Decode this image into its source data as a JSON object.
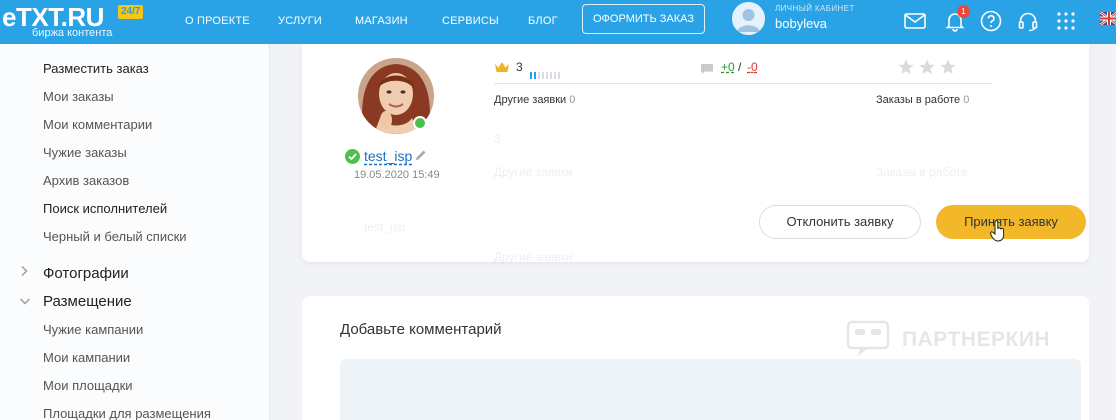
{
  "header": {
    "logo_text": "eTXT.RU",
    "logo_badge": "24/7",
    "logo_sub": "биржа контента",
    "nav": [
      "О ПРОЕКТЕ",
      "УСЛУГИ",
      "МАГАЗИН",
      "СЕРВИСЫ",
      "БЛОГ"
    ],
    "order_button": "ОФОРМИТЬ ЗАКАЗ",
    "cabinet_label": "ЛИЧНЫЙ КАБИНЕТ",
    "username": "bobyleva",
    "notification_count": "1",
    "icons": [
      "mail-icon",
      "bell-icon",
      "help-icon",
      "headset-icon",
      "apps-grid-icon",
      "uk-flag-icon"
    ]
  },
  "sidebar": {
    "items": [
      "Разместить заказ",
      "Мои заказы",
      "Мои комментарии",
      "Чужие заказы",
      "Архив заказов",
      "Поиск исполнителей",
      "Черный и белый списки"
    ],
    "cat_photos": "Фотографии",
    "cat_placement": "Размещение",
    "sub_items": [
      "Чужие кампании",
      "Мои кампании",
      "Мои площадки",
      "Площадки для размещения"
    ]
  },
  "request": {
    "username": "test_isp",
    "date": "19.05.2020 15:49",
    "rating": "3",
    "positive": "+0",
    "separator": "/",
    "negative": "-0",
    "other_requests_label": "Другие заявки",
    "other_requests_count": "0",
    "orders_in_work_label": "Заказы в работе",
    "orders_in_work_count": "0",
    "reject_button": "Отклонить заявку",
    "accept_button": "Принять заявку"
  },
  "comment": {
    "title": "Добавьте комментарий"
  },
  "watermark": "ПАРТНЕРКИН",
  "colors": {
    "header": "#2aa3e6",
    "accept": "#f2b82a",
    "positive": "#2e9b2e",
    "negative": "#d63b2b",
    "link": "#1a72c0"
  }
}
